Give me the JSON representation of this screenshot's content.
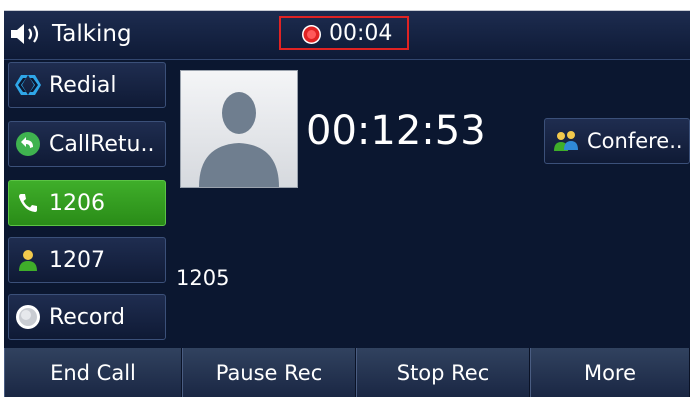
{
  "status_bar": {
    "icon": "speaker-icon",
    "state_text": "Talking",
    "recording_time": "00:04",
    "recording_color": "#e02323"
  },
  "side_buttons": [
    {
      "label": "Redial",
      "icon": "redial-icon",
      "active": false
    },
    {
      "label": "CallRetu..",
      "icon": "callreturn-icon",
      "active": false
    },
    {
      "label": "1206",
      "icon": "phone-handset-icon",
      "active": true
    },
    {
      "label": "1207",
      "icon": "contact-icon",
      "active": false
    },
    {
      "label": "Record",
      "icon": "record-icon",
      "active": false
    }
  ],
  "call": {
    "duration": "00:12:53",
    "caller": "1205",
    "avatar_icon": "person-silhouette-icon"
  },
  "conference": {
    "label": "Confere..",
    "icon": "conference-icon"
  },
  "softkeys": [
    "End Call",
    "Pause Rec",
    "Stop Rec",
    "More"
  ],
  "colors": {
    "background": "#0b1730",
    "active_line": "#3fae2a",
    "accent": "#e02323"
  }
}
